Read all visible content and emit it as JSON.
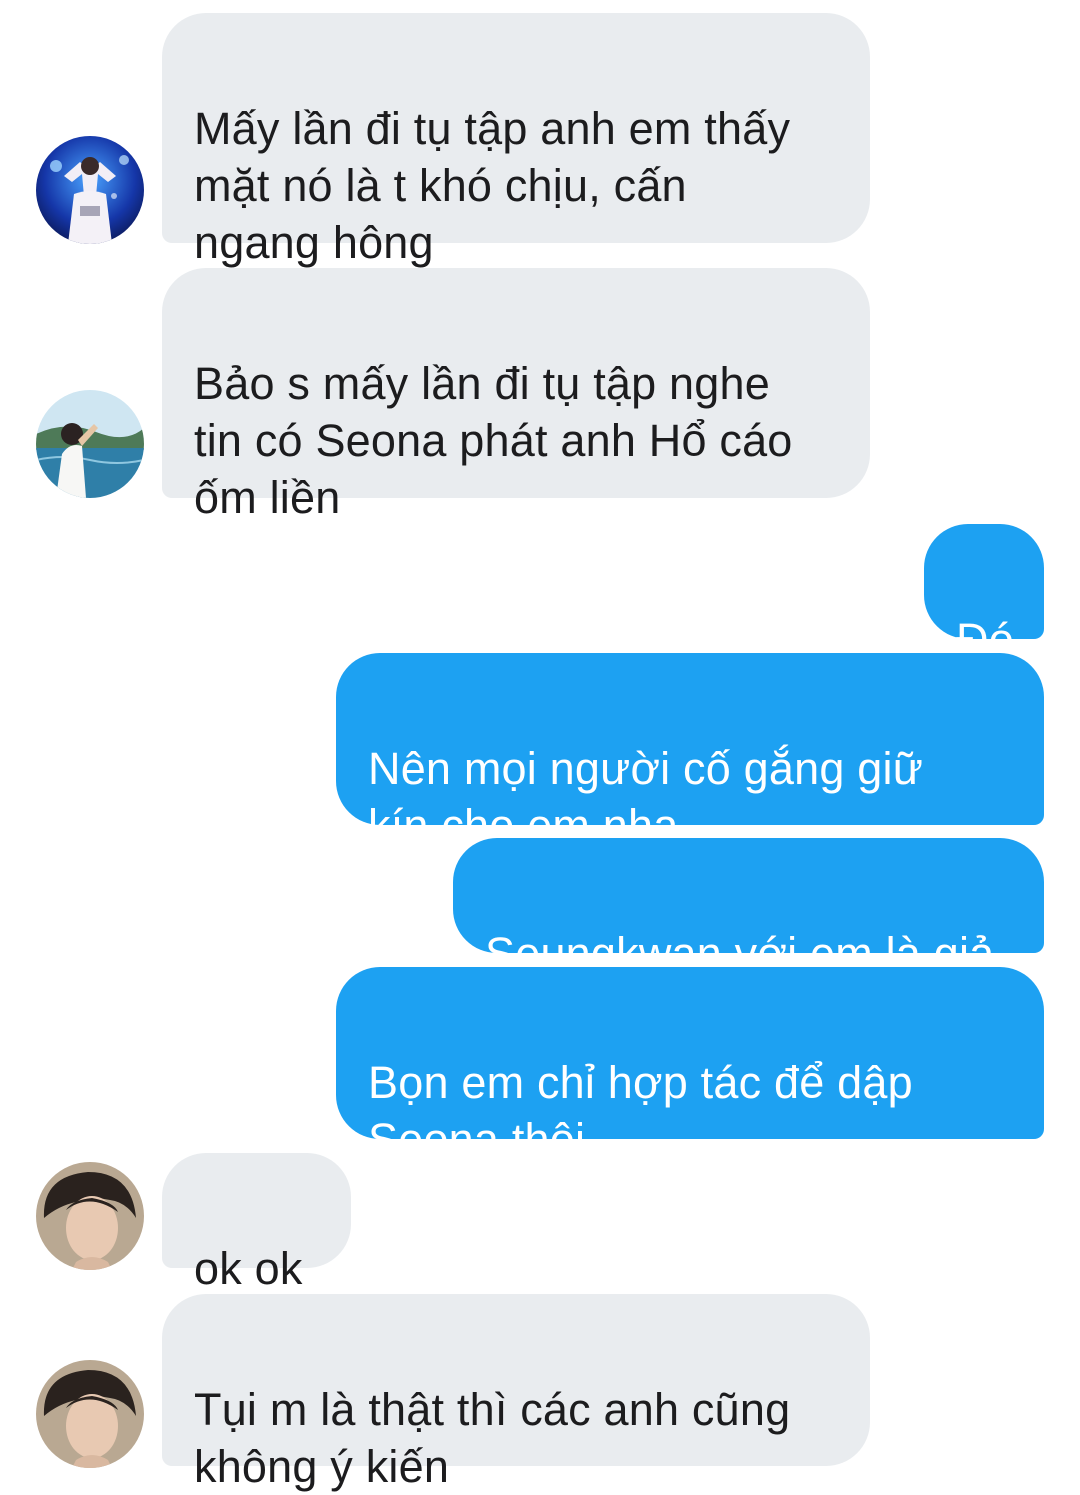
{
  "conversation": {
    "messages": [
      {
        "sender": "other",
        "avatar": "avatar-concert-icon",
        "text": "Mấy lần đi tụ tập anh em thấy\nmặt nó là t khó chịu, cấn\nngang hông"
      },
      {
        "sender": "other",
        "avatar": "avatar-seaside-icon",
        "text": "Bảo s mấy lần đi tụ tập nghe\ntin có Seona phát anh Hổ cáo\nốm liền"
      },
      {
        "sender": "self",
        "text": "Đó"
      },
      {
        "sender": "self",
        "text": "Nên mọi người cố gắng giữ\nkín cho em nha"
      },
      {
        "sender": "self",
        "text": "Seungkwan với em là giả"
      },
      {
        "sender": "self",
        "text": "Bọn em chỉ hợp tác để dập\nSeona thôi"
      },
      {
        "sender": "other",
        "avatar": "avatar-portrait-icon",
        "text": "ok ok"
      },
      {
        "sender": "other",
        "avatar": "avatar-portrait-icon",
        "text": "Tụi m là thật thì các anh cũng\nkhông ý kiến"
      }
    ]
  },
  "colors": {
    "incoming_bubble": "#e9ecef",
    "outgoing_bubble": "#1da1f2",
    "incoming_text": "#1c1c1e",
    "outgoing_text": "#ffffff"
  }
}
